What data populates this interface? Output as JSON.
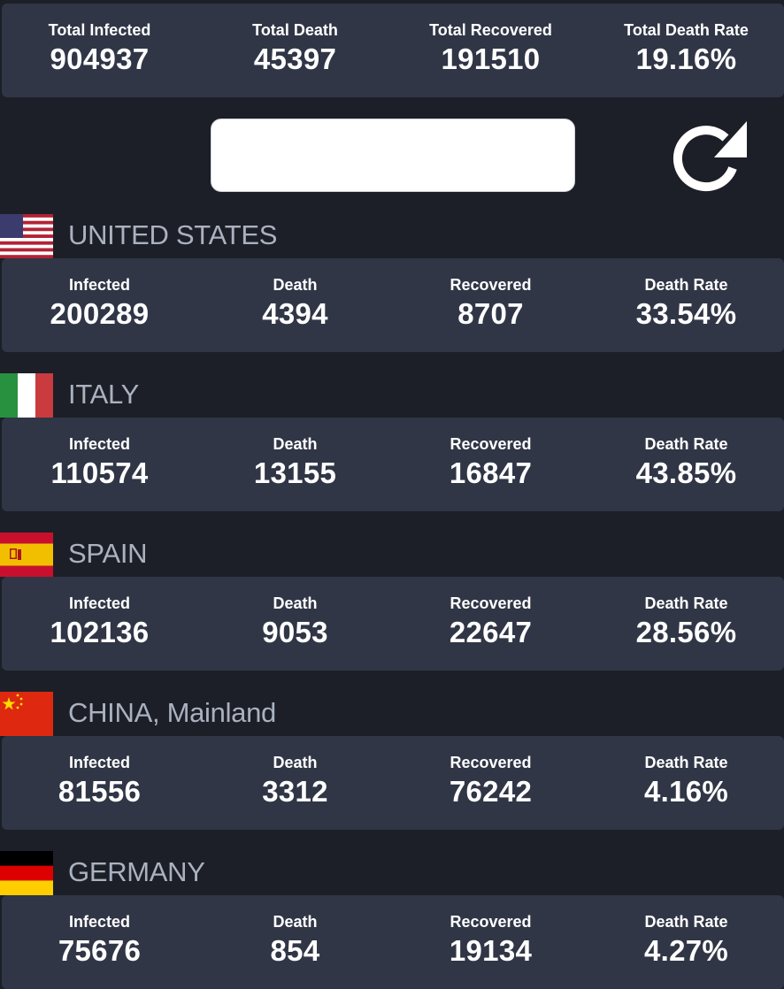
{
  "summary": {
    "labels": [
      "Total Infected",
      "Total Death",
      "Total Recovered",
      "Total Death Rate"
    ],
    "values": [
      "904937",
      "45397",
      "191510",
      "19.16%"
    ]
  },
  "search": {
    "placeholder": "",
    "value": ""
  },
  "refresh_icon": "refresh-icon",
  "stat_labels": [
    "Infected",
    "Death",
    "Recovered",
    "Death Rate"
  ],
  "countries": [
    {
      "name": "UNITED STATES",
      "flag": "us-flag-icon",
      "values": [
        "200289",
        "4394",
        "8707",
        "33.54%"
      ]
    },
    {
      "name": "ITALY",
      "flag": "italy-flag-icon",
      "values": [
        "110574",
        "13155",
        "16847",
        "43.85%"
      ]
    },
    {
      "name": "SPAIN",
      "flag": "spain-flag-icon",
      "values": [
        "102136",
        "9053",
        "22647",
        "28.56%"
      ]
    },
    {
      "name": "CHINA, Mainland",
      "flag": "china-flag-icon",
      "values": [
        "81556",
        "3312",
        "76242",
        "4.16%"
      ]
    },
    {
      "name": "GERMANY",
      "flag": "germany-flag-icon",
      "values": [
        "75676",
        "854",
        "19134",
        "4.27%"
      ]
    }
  ],
  "colors": {
    "background": "#1c1f27",
    "card": "#303646",
    "country_name": "#aab1bf",
    "text": "#ffffff"
  }
}
